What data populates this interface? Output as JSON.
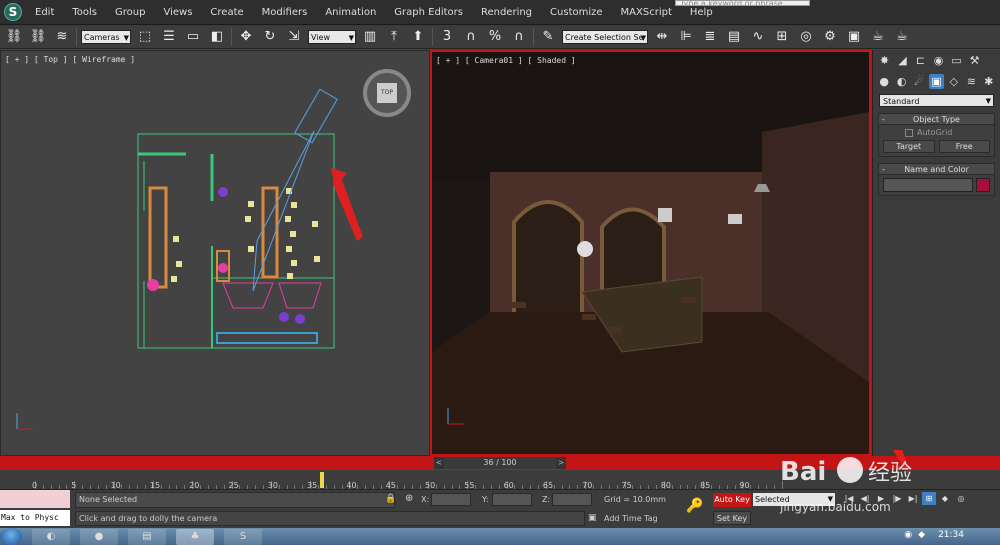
{
  "menu": {
    "items": [
      "Edit",
      "Tools",
      "Group",
      "Views",
      "Create",
      "Modifiers",
      "Animation",
      "Graph Editors",
      "Rendering",
      "Customize",
      "MAXScript",
      "Help"
    ],
    "search_placeholder": "Type a keyword or phrase"
  },
  "toolbar": {
    "filter_value": "Cameras",
    "refcoord_value": "View",
    "selection_set_placeholder": "Create Selection Se",
    "snap_label": "3"
  },
  "viewports": {
    "top_label": "[ + ] [ Top ] [ Wireframe ]",
    "camera_label": "[ + ] [ Camera01 ] [ Shaded ]",
    "viewcube_label": "TOP"
  },
  "command_panel": {
    "category_value": "Standard",
    "object_type_title": "Object Type",
    "autogrid_label": "AutoGrid",
    "target_button": "Target",
    "free_button": "Free",
    "name_color_title": "Name and Color",
    "object_color": "#a4103a"
  },
  "timeline": {
    "frame_display": "36 / 100",
    "ruler_numbers": [
      "0",
      "5",
      "10",
      "15",
      "20",
      "25",
      "30",
      "35",
      "40",
      "45",
      "50",
      "55",
      "60",
      "65",
      "70",
      "75",
      "80",
      "85",
      "90"
    ]
  },
  "status": {
    "maxscript_text": "Max to Physc",
    "selection_text": "None Selected",
    "prompt_text": "Click and drag to dolly the camera",
    "x_label": "X:",
    "y_label": "Y:",
    "z_label": "Z:",
    "grid_text": "Grid = 10.0mm",
    "add_time_tag": "Add Time Tag",
    "auto_key": "Auto Key",
    "set_key": "Set Key",
    "key_filter_value": "Selected"
  },
  "taskbar": {
    "clock": "21:34"
  },
  "watermark": {
    "brand": "Bai",
    "brand_cn": "经验",
    "url": "jingyan.baidu.com"
  }
}
